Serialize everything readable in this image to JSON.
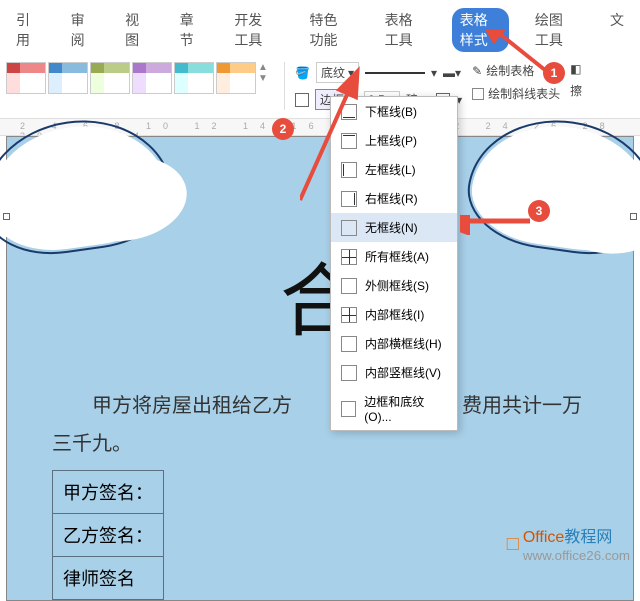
{
  "tabs": {
    "t0": "引用",
    "t1": "审阅",
    "t2": "视图",
    "t3": "章节",
    "t4": "开发工具",
    "t5": "特色功能",
    "t6": "表格工具",
    "t7": "表格样式",
    "t8": "绘图工具",
    "t9": "文"
  },
  "toolbar": {
    "shading": "底纹",
    "border": "边框",
    "width": "0.5",
    "unit": "磅",
    "drawTable": "绘制表格",
    "drawDiagHeader": "绘制斜线表头",
    "eraser": "擦"
  },
  "dropdown": {
    "bottom": "下框线(B)",
    "top": "上框线(P)",
    "left": "左框线(L)",
    "right": "右框线(R)",
    "none": "无框线(N)",
    "all": "所有框线(A)",
    "outside": "外侧框线(S)",
    "inside": "内部框线(I)",
    "insideH": "内部横框线(H)",
    "insideV": "内部竖框线(V)",
    "bordersShading": "边框和底纹(O)..."
  },
  "doc": {
    "heading": "合",
    "para1": "甲方将房屋出租给乙方",
    "para2": "包水电费，费用共计一万三千九。",
    "sign1": "甲方签名：",
    "sign2": "乙方签名：",
    "sign3": "律师签名"
  },
  "markers": {
    "m1": "1",
    "m2": "2",
    "m3": "3"
  },
  "watermark": {
    "brand1": "Office",
    "brand2": "教程网",
    "url": "www.office26.com"
  }
}
